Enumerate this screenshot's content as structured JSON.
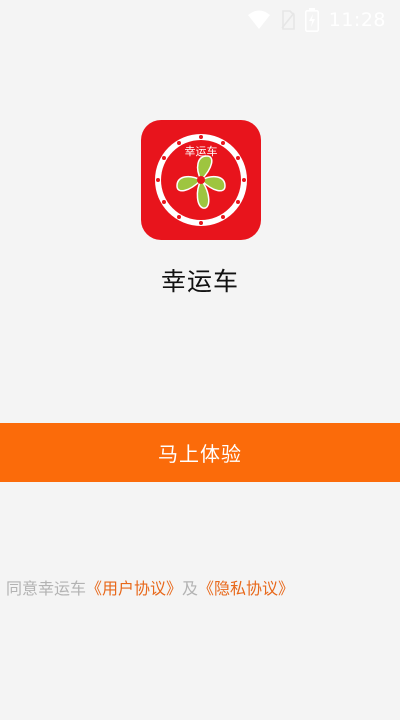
{
  "status_bar": {
    "time": "11:28",
    "icons": [
      "wifi-icon",
      "no-sim-icon",
      "battery-charging-icon"
    ]
  },
  "app": {
    "name": "幸运车",
    "logo_text": "幸运车",
    "logo_icon": "four-leaf-clover-icon",
    "brand_color": "#e8141c"
  },
  "start_button": {
    "label": "马上体验",
    "color": "#fb6b0a"
  },
  "agreement": {
    "prefix": "同意幸运车",
    "user_agreement": "《用户协议》",
    "conjunction": "及",
    "privacy_policy": "《隐私协议》",
    "link_color": "#e8681a"
  }
}
